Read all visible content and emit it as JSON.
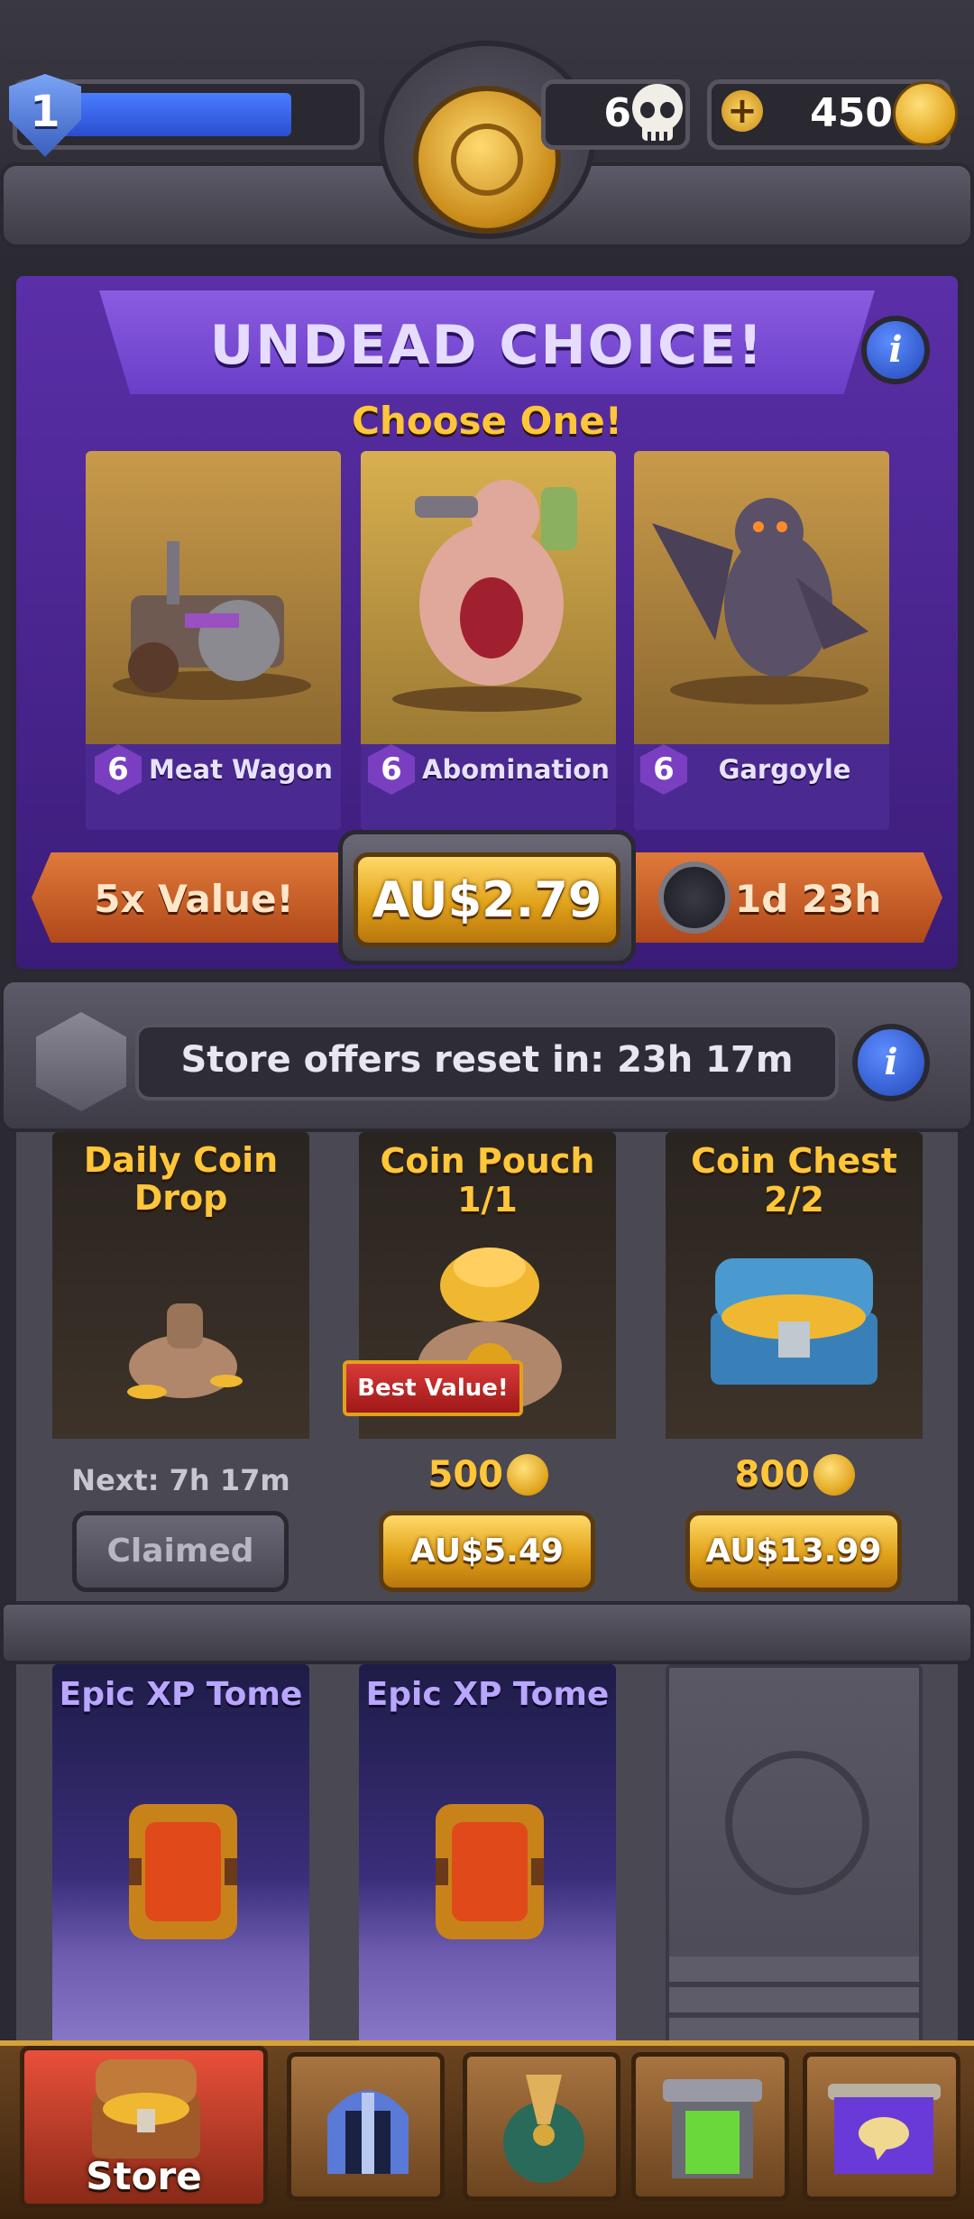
{
  "header": {
    "player_level": "1",
    "xp_progress": 0.8,
    "skulls": "6",
    "coins": "450",
    "add_label": "+"
  },
  "featured": {
    "title": "UNDEAD CHOICE!",
    "subtitle": "Choose One!",
    "info_label": "i",
    "units": [
      {
        "level": "6",
        "name": "Meat Wagon"
      },
      {
        "level": "6",
        "name": "Abomination"
      },
      {
        "level": "6",
        "name": "Gargoyle"
      }
    ],
    "value_badge": "5x Value!",
    "price": "AU$2.79",
    "timer": "1d 23h"
  },
  "reset_bar": {
    "text": "Store offers reset in: 23h 17m",
    "info_label": "i"
  },
  "offers": [
    {
      "title": "Daily Coin Drop",
      "note": "Next: 7h 17m",
      "button": "Claimed"
    },
    {
      "title": "Coin Pouch",
      "count": "1/1",
      "badge": "Best Value!",
      "amount": "500",
      "button": "AU$5.49"
    },
    {
      "title": "Coin Chest",
      "count": "2/2",
      "amount": "800",
      "button": "AU$13.99"
    }
  ],
  "tomes": [
    {
      "title": "Epic XP Tome"
    },
    {
      "title": "Epic XP Tome"
    }
  ],
  "nav": {
    "active_label": "Store"
  },
  "colors": {
    "accent_gold": "#ffc63a",
    "purple": "#5b2fa8",
    "tome_title": "#b8a6ff",
    "stone": "#4a4853"
  }
}
